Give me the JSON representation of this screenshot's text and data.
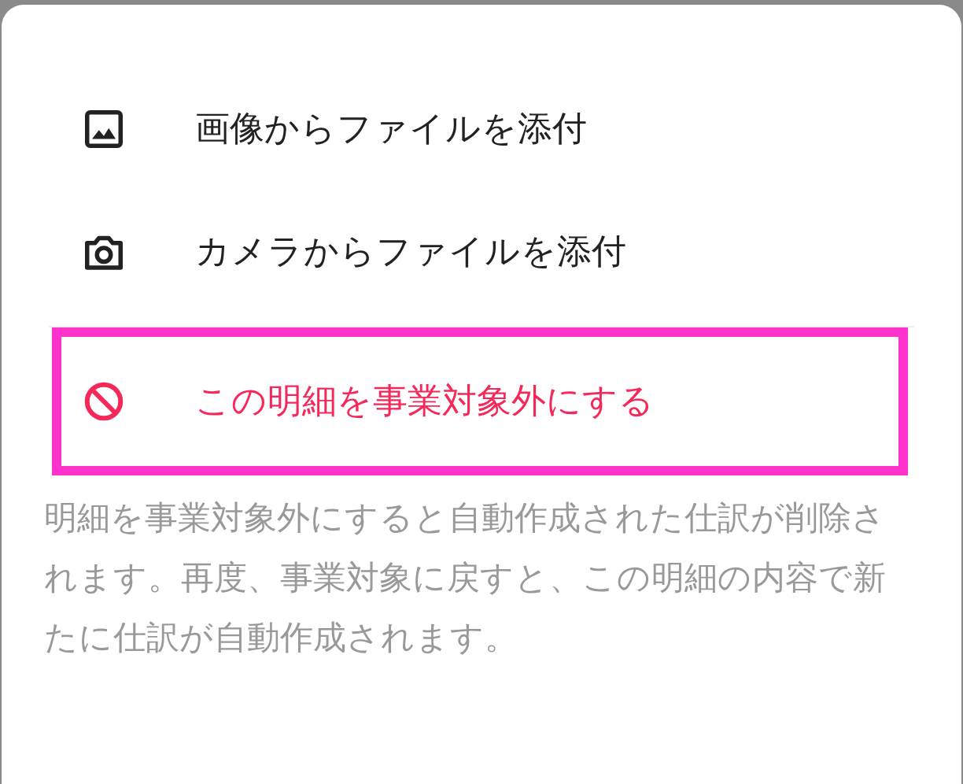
{
  "menu_items": [
    {
      "kind": "image",
      "label": "画像からファイルを添付",
      "danger": false,
      "highlighted": false
    },
    {
      "kind": "camera",
      "label": "カメラからファイルを添付",
      "danger": false,
      "highlighted": false
    },
    {
      "kind": "exclude",
      "label": "この明細を事業対象外にする",
      "danger": true,
      "highlighted": true
    }
  ],
  "note": "明細を事業対象外にすると自動作成された仕訳が削除されます。再度、事業対象に戻すと、この明細の内容で新たに仕訳が自動作成されます。"
}
